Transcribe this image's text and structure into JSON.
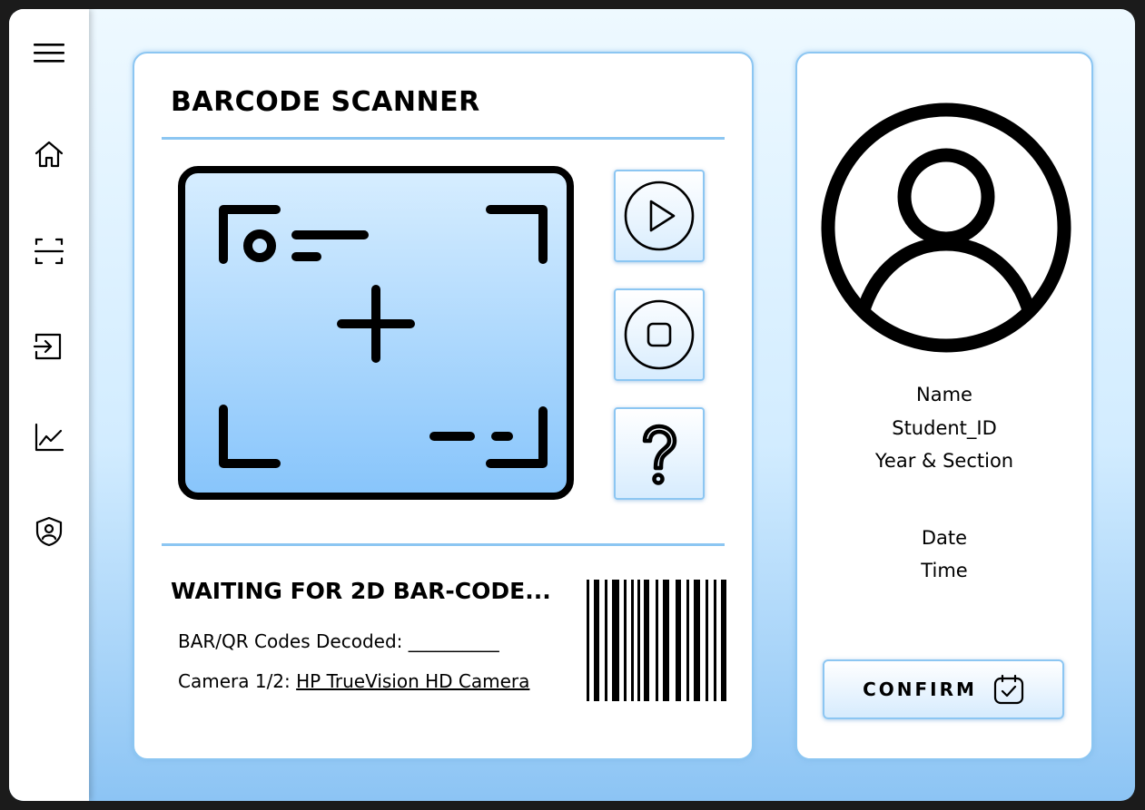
{
  "sidebar": {
    "items": [
      {
        "icon": "menu-icon"
      },
      {
        "icon": "home-icon"
      },
      {
        "icon": "scan-icon"
      },
      {
        "icon": "login-icon"
      },
      {
        "icon": "chart-icon"
      },
      {
        "icon": "user-shield-icon"
      }
    ]
  },
  "scanner": {
    "title": "BARCODE SCANNER",
    "status": "WAITING FOR 2D BAR-CODE...",
    "decoded_label": "BAR/QR Codes Decoded:",
    "decoded_value": "__________",
    "camera_label": "Camera 1/2:",
    "camera_name": "HP TrueVision HD Camera",
    "controls": [
      {
        "icon": "play-icon"
      },
      {
        "icon": "stop-icon"
      },
      {
        "icon": "help-icon"
      }
    ]
  },
  "profile": {
    "avatar_icon": "user-avatar-icon",
    "name": "Name",
    "student_id": "Student_ID",
    "year_section": "Year & Section",
    "date": "Date",
    "time": "Time",
    "confirm_label": "CONFIRM",
    "confirm_icon": "calendar-check-icon"
  },
  "colors": {
    "accent": "#8cc6f2",
    "background_top": "#eef9ff",
    "background_bottom": "#8cc4f4"
  }
}
